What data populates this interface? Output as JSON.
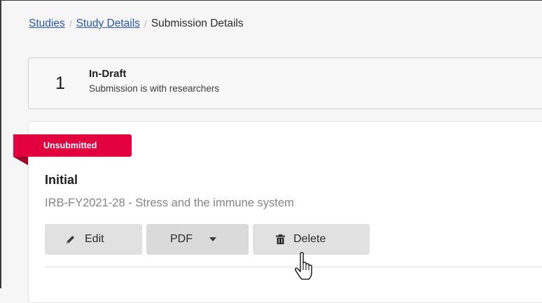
{
  "breadcrumb": {
    "studies": "Studies",
    "study_details": "Study Details",
    "separator": "/",
    "current": "Submission Details"
  },
  "status": {
    "number": "1",
    "title": "In-Draft",
    "subtitle": "Submission is with researchers"
  },
  "submission": {
    "badge": "Unsubmitted",
    "title": "Initial",
    "description": "IRB-FY2021-28 - Stress and the immune system"
  },
  "actions": {
    "edit_label": "Edit",
    "pdf_label": "PDF",
    "delete_label": "Delete"
  },
  "icons": {
    "edit": "pencil-icon",
    "pdf_dropdown": "caret-down-icon",
    "delete": "trash-icon",
    "cursor": "hand-pointer-cursor-icon"
  },
  "colors": {
    "badge": "#e3003f",
    "link": "#2a55b4",
    "button": "#e1e1e1"
  }
}
